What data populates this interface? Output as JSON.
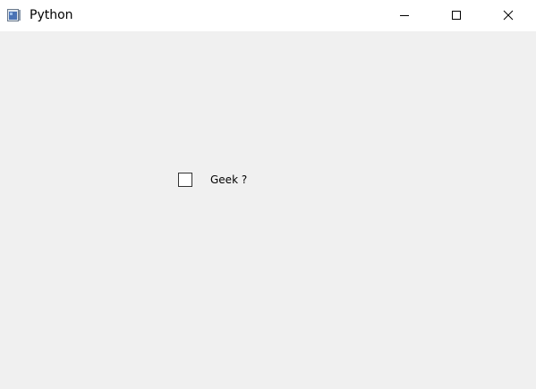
{
  "window": {
    "title": "Python",
    "icons": {
      "app": "python-app-icon",
      "minimize": "minimize-icon",
      "maximize": "maximize-icon",
      "close": "close-icon"
    }
  },
  "content": {
    "checkbox": {
      "label": "Geek ?",
      "checked": false
    }
  },
  "colors": {
    "titlebar": "#ffffff",
    "client": "#f0f0f0",
    "checkbox_border": "#333333"
  }
}
